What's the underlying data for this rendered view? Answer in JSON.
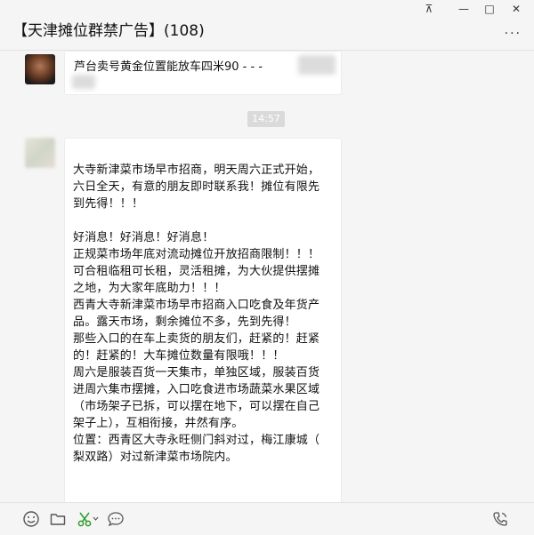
{
  "window": {
    "title": "【天津摊位群禁广告】(108)",
    "controls": {
      "pin": "⊼",
      "minimize": "—",
      "maximize": "□",
      "close": "✕"
    },
    "more_label": "..."
  },
  "messages": [
    {
      "id": "msg1",
      "text": "芦台卖号黄金位置能放车四米90 -  -  -"
    },
    {
      "id": "msg2",
      "lines": [
        "大寺新津菜市场早市招商，明天周六正式开始，",
        "六日全天，有意的朋友即时联系我！摊位有限先",
        "到先得！！！",
        "",
        "好消息！好消息！好消息！",
        "正规菜市场年底对流动摊位开放招商限制！！！",
        "可合租临租可长租，灵活租摊，为大伙提供摆摊",
        "之地，为大家年底助力！！！",
        "西青大寺新津菜市场早市招商入口吃食及年货产",
        "品。露天市场，剩余摊位不多，先到先得！",
        "那些入口的在车上卖货的朋友们，赶紧的！赶紧",
        "的！赶紧的！大车摊位数量有限哦！！！",
        "周六是服装百货一天集市，单独区域，服装百货",
        "进周六集市摆摊，入口吃食进市场蔬菜水果区域",
        "（市场架子已拆，可以摆在地下，可以摆在自己",
        "架子上），互相衔接，井然有序。",
        "位置：西青区大寺永旺侧门斜对过，梅江康城（",
        "梨双路）对过新津菜市场院内。"
      ]
    }
  ],
  "timestamp": "14:57",
  "toolbar_icons": [
    "emoji-icon",
    "folder-icon",
    "scissors-icon",
    "chat-bubble-icon",
    "phone-icon"
  ]
}
